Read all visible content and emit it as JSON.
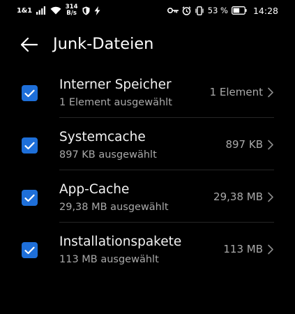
{
  "status_bar": {
    "carrier": "1&1",
    "speed_value": "314",
    "speed_unit": "B/s",
    "battery_percent": "53 %",
    "time": "14:28",
    "icons": [
      "signal-icon",
      "wifi-icon",
      "shield-icon",
      "flash-icon",
      "key-icon",
      "alarm-icon",
      "vibrate-icon",
      "battery-icon"
    ]
  },
  "header": {
    "title": "Junk-Dateien",
    "back_icon": "back-arrow-icon"
  },
  "accent_color": "#1e6fd9",
  "items": [
    {
      "title": "Interner Speicher",
      "subtitle": "1 Element ausgewählt",
      "value": "1 Element",
      "checked": true
    },
    {
      "title": "Systemcache",
      "subtitle": "897 KB ausgewählt",
      "value": "897 KB",
      "checked": true
    },
    {
      "title": "App-Cache",
      "subtitle": "29,38 MB ausgewählt",
      "value": "29,38 MB",
      "checked": true
    },
    {
      "title": "Installationspakete",
      "subtitle": "113 MB ausgewählt",
      "value": "113 MB",
      "checked": true
    }
  ]
}
